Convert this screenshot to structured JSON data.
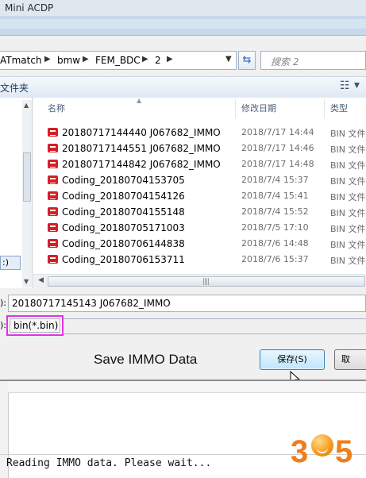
{
  "app": {
    "title": "Mini ACDP"
  },
  "breadcrumb": {
    "items": [
      "ATmatch",
      "bmw",
      "FEM_BDC",
      "2"
    ]
  },
  "search": {
    "placeholder": "搜索 2"
  },
  "toolbar": {
    "organize_label": "文件夹",
    "view_icon": "view-options-icon"
  },
  "left_pane": {
    "selected_label": ":)"
  },
  "columns": {
    "name": "名称",
    "modified": "修改日期",
    "type": "类型"
  },
  "files": [
    {
      "name": "20180717144440 J067682_IMMO",
      "date": "2018/7/17 14:44",
      "type": "BIN 文件"
    },
    {
      "name": "20180717144551 J067682_IMMO",
      "date": "2018/7/17 14:46",
      "type": "BIN 文件"
    },
    {
      "name": "20180717144842 J067682_IMMO",
      "date": "2018/7/17 14:48",
      "type": "BIN 文件"
    },
    {
      "name": "Coding_20180704153705",
      "date": "2018/7/4 15:37",
      "type": "BIN 文件"
    },
    {
      "name": "Coding_20180704154126",
      "date": "2018/7/4 15:41",
      "type": "BIN 文件"
    },
    {
      "name": "Coding_20180704155148",
      "date": "2018/7/4 15:52",
      "type": "BIN 文件"
    },
    {
      "name": "Coding_20180705171003",
      "date": "2018/7/5 17:10",
      "type": "BIN 文件"
    },
    {
      "name": "Coding_20180706144838",
      "date": "2018/7/6 14:48",
      "type": "BIN 文件"
    },
    {
      "name": "Coding_20180706153711",
      "date": "2018/7/6 15:37",
      "type": "BIN 文件"
    }
  ],
  "form": {
    "filename_label": "):",
    "filename_value": "20180717145143 J067682_IMMO",
    "filetype_label": "):",
    "filetype_value": "bin(*.bin)"
  },
  "overlay": {
    "caption": "Save IMMO Data"
  },
  "buttons": {
    "save": "保存(S)",
    "cancel": "取"
  },
  "status": {
    "text": "Reading IMMO data. Please wait..."
  },
  "logo": {
    "digits": [
      "3",
      "5"
    ]
  },
  "colors": {
    "highlight": "#e232e0",
    "icon_red": "#d41f27",
    "logo_orange": "#f07e1a"
  }
}
